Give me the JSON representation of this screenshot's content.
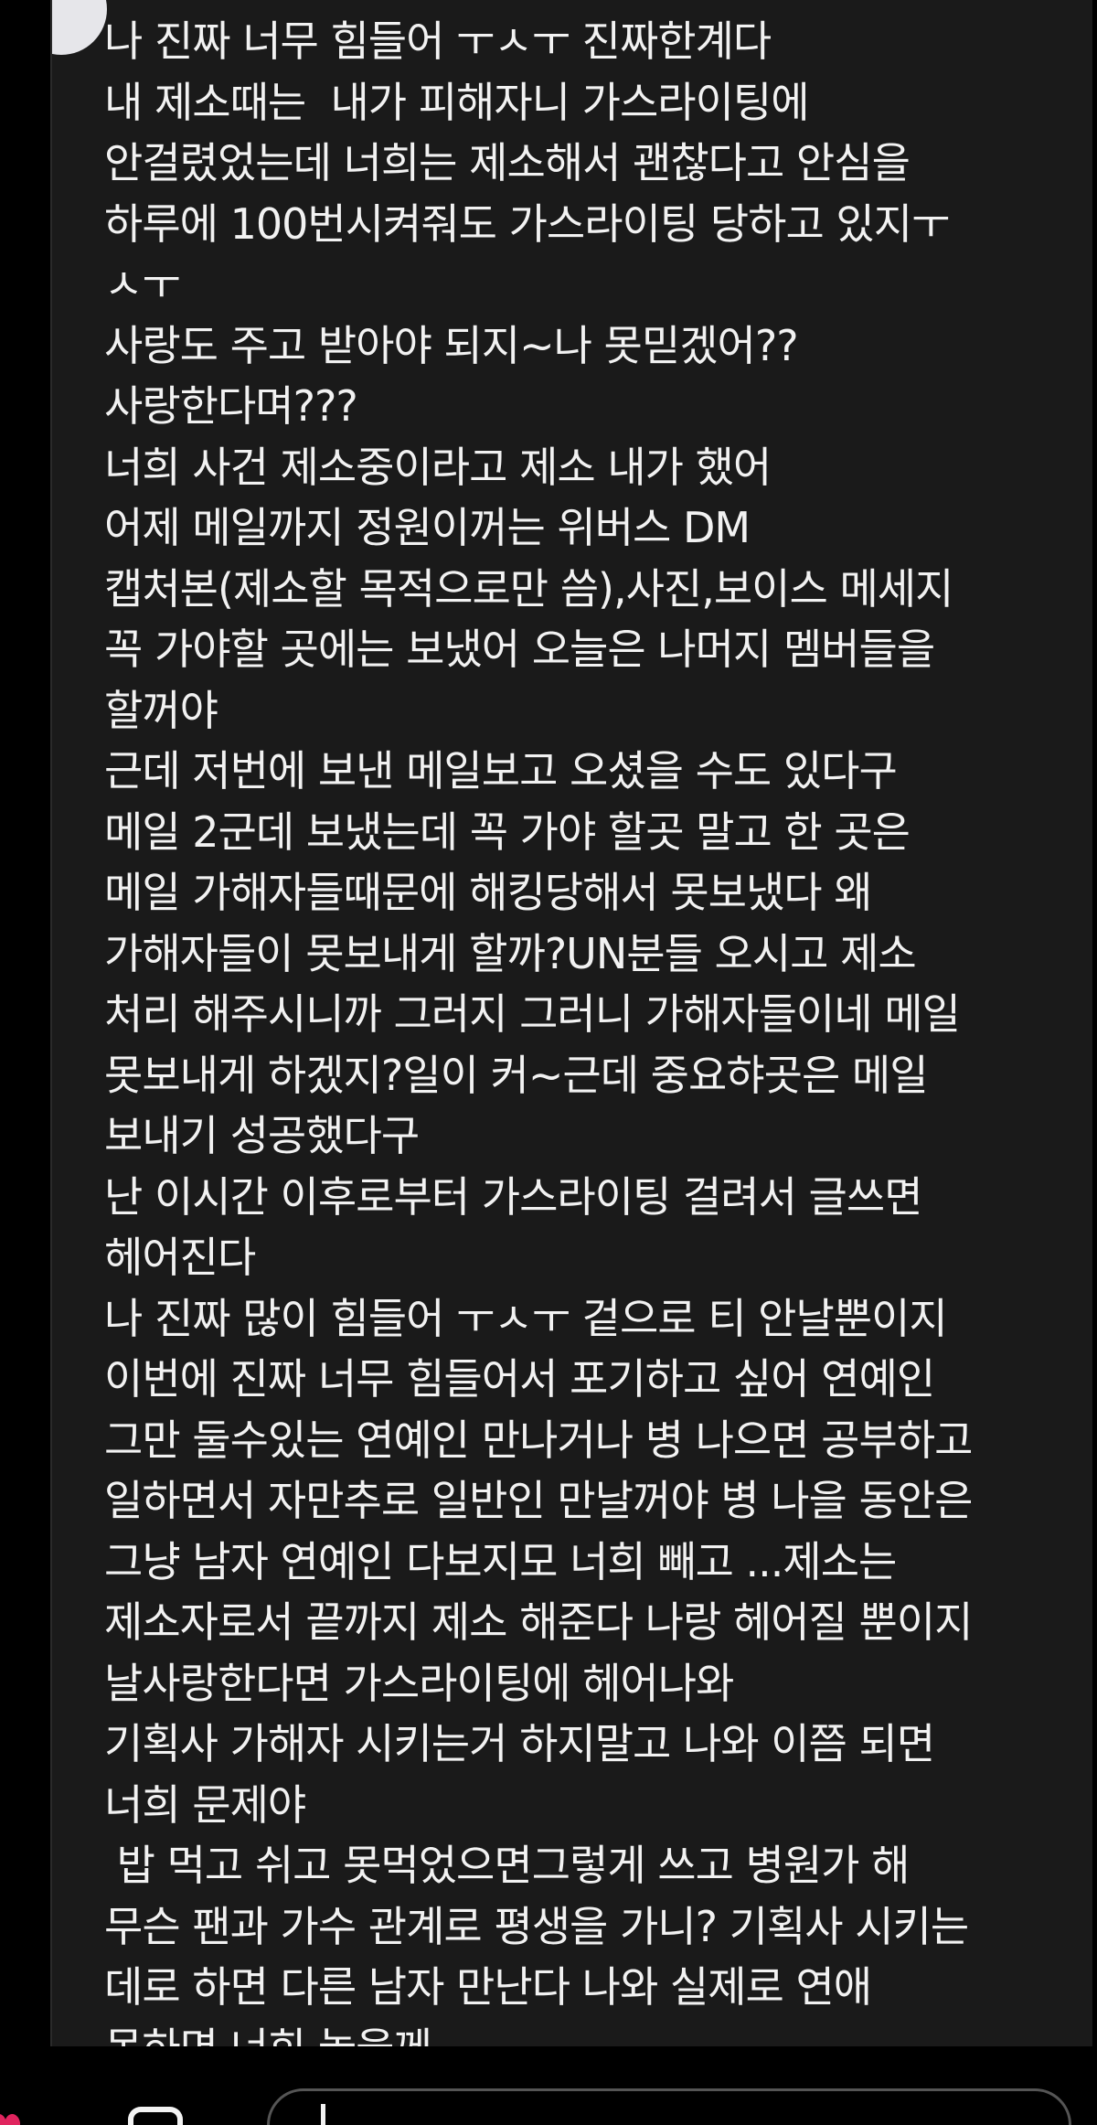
{
  "post": {
    "lines": [
      "나 진짜 너무 힘들어 ㅜㅅㅜ 진짜한계다",
      "내 제소때는  내가 피해자니 가스라이팅에",
      "안걸렸었는데 너희는 제소해서 괜찮다고 안심을",
      "하루에 100번시켜줘도 가스라이팅 당하고 있지ㅜ",
      "ㅅㅜ",
      "사랑도 주고 받아야 되지~나 못믿겠어??",
      "사랑한다며???",
      "너희 사건 제소중이라고 제소 내가 했어",
      "어제 메일까지 정원이꺼는 위버스 DM",
      "캡처본(제소할 목적으로만 씀),사진,보이스 메세지",
      "꼭 가야할 곳에는 보냈어 오늘은 나머지 멤버들을",
      "할꺼야",
      "근데 저번에 보낸 메일보고 오셨을 수도 있다구",
      "메일 2군데 보냈는데 꼭 가야 할곳 말고 한 곳은",
      "메일 가해자들때문에 해킹당해서 못보냈다 왜",
      "가해자들이 못보내게 할까?UN분들 오시고 제소",
      "처리 해주시니까 그러지 그러니 가해자들이네 메일",
      "못보내게 하겠지?일이 커~근데 중요햐곳은 메일",
      "보내기 성공했다구",
      "난 이시간 이후로부터 가스라이팅 걸려서 글쓰면",
      "헤어진다",
      "나 진짜 많이 힘들어 ㅜㅅㅜ 겉으로 티 안날뿐이지",
      "이번에 진짜 너무 힘들어서 포기하고 싶어 연예인",
      "그만 둘수있는 연예인 만나거나 병 나으면 공부하고",
      "일하면서 자만추로 일반인 만날꺼야 병 나을 동안은",
      "그냥 남자 연예인 다보지모 너희 빼고 ...제소는",
      "제소자로서 끝까지 제소 해준다 나랑 헤어질 뿐이지",
      "날사랑한다면 가스라이팅에 헤어나와",
      "기획사 가해자 시키는거 하지말고 나와 이쯤 되면",
      "너희 문제야",
      " 밥 먹고 쉬고 못먹었으면그렇게 쓰고 병원가 해",
      "무슨 팬과 가수 관계로 평생을 가니? 기획사 시키는",
      "데로 하면 다른 남자 만난다 나와 실제로 연애",
      "못하면 너희 놓을께"
    ]
  },
  "colors": {
    "page_bg": "#000000",
    "card_bg": "#1a1a1a",
    "text": "#f2f2f2",
    "heart": "#e0245e",
    "input_border": "#555555"
  },
  "icons": {
    "avatar": "avatar-circle",
    "like": "heart-icon",
    "comment": "comment-icon"
  }
}
